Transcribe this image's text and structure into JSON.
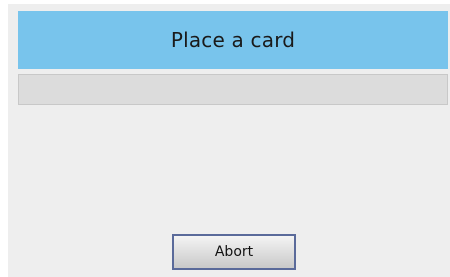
{
  "header": {
    "title": "Place a card"
  },
  "status": {
    "text": ""
  },
  "actions": {
    "abort_label": "Abort"
  },
  "colors": {
    "header_background": "#78c4ec",
    "window_background": "#eeeeee",
    "status_background": "#dcdcdc",
    "button_border": "#5a6a9a"
  }
}
